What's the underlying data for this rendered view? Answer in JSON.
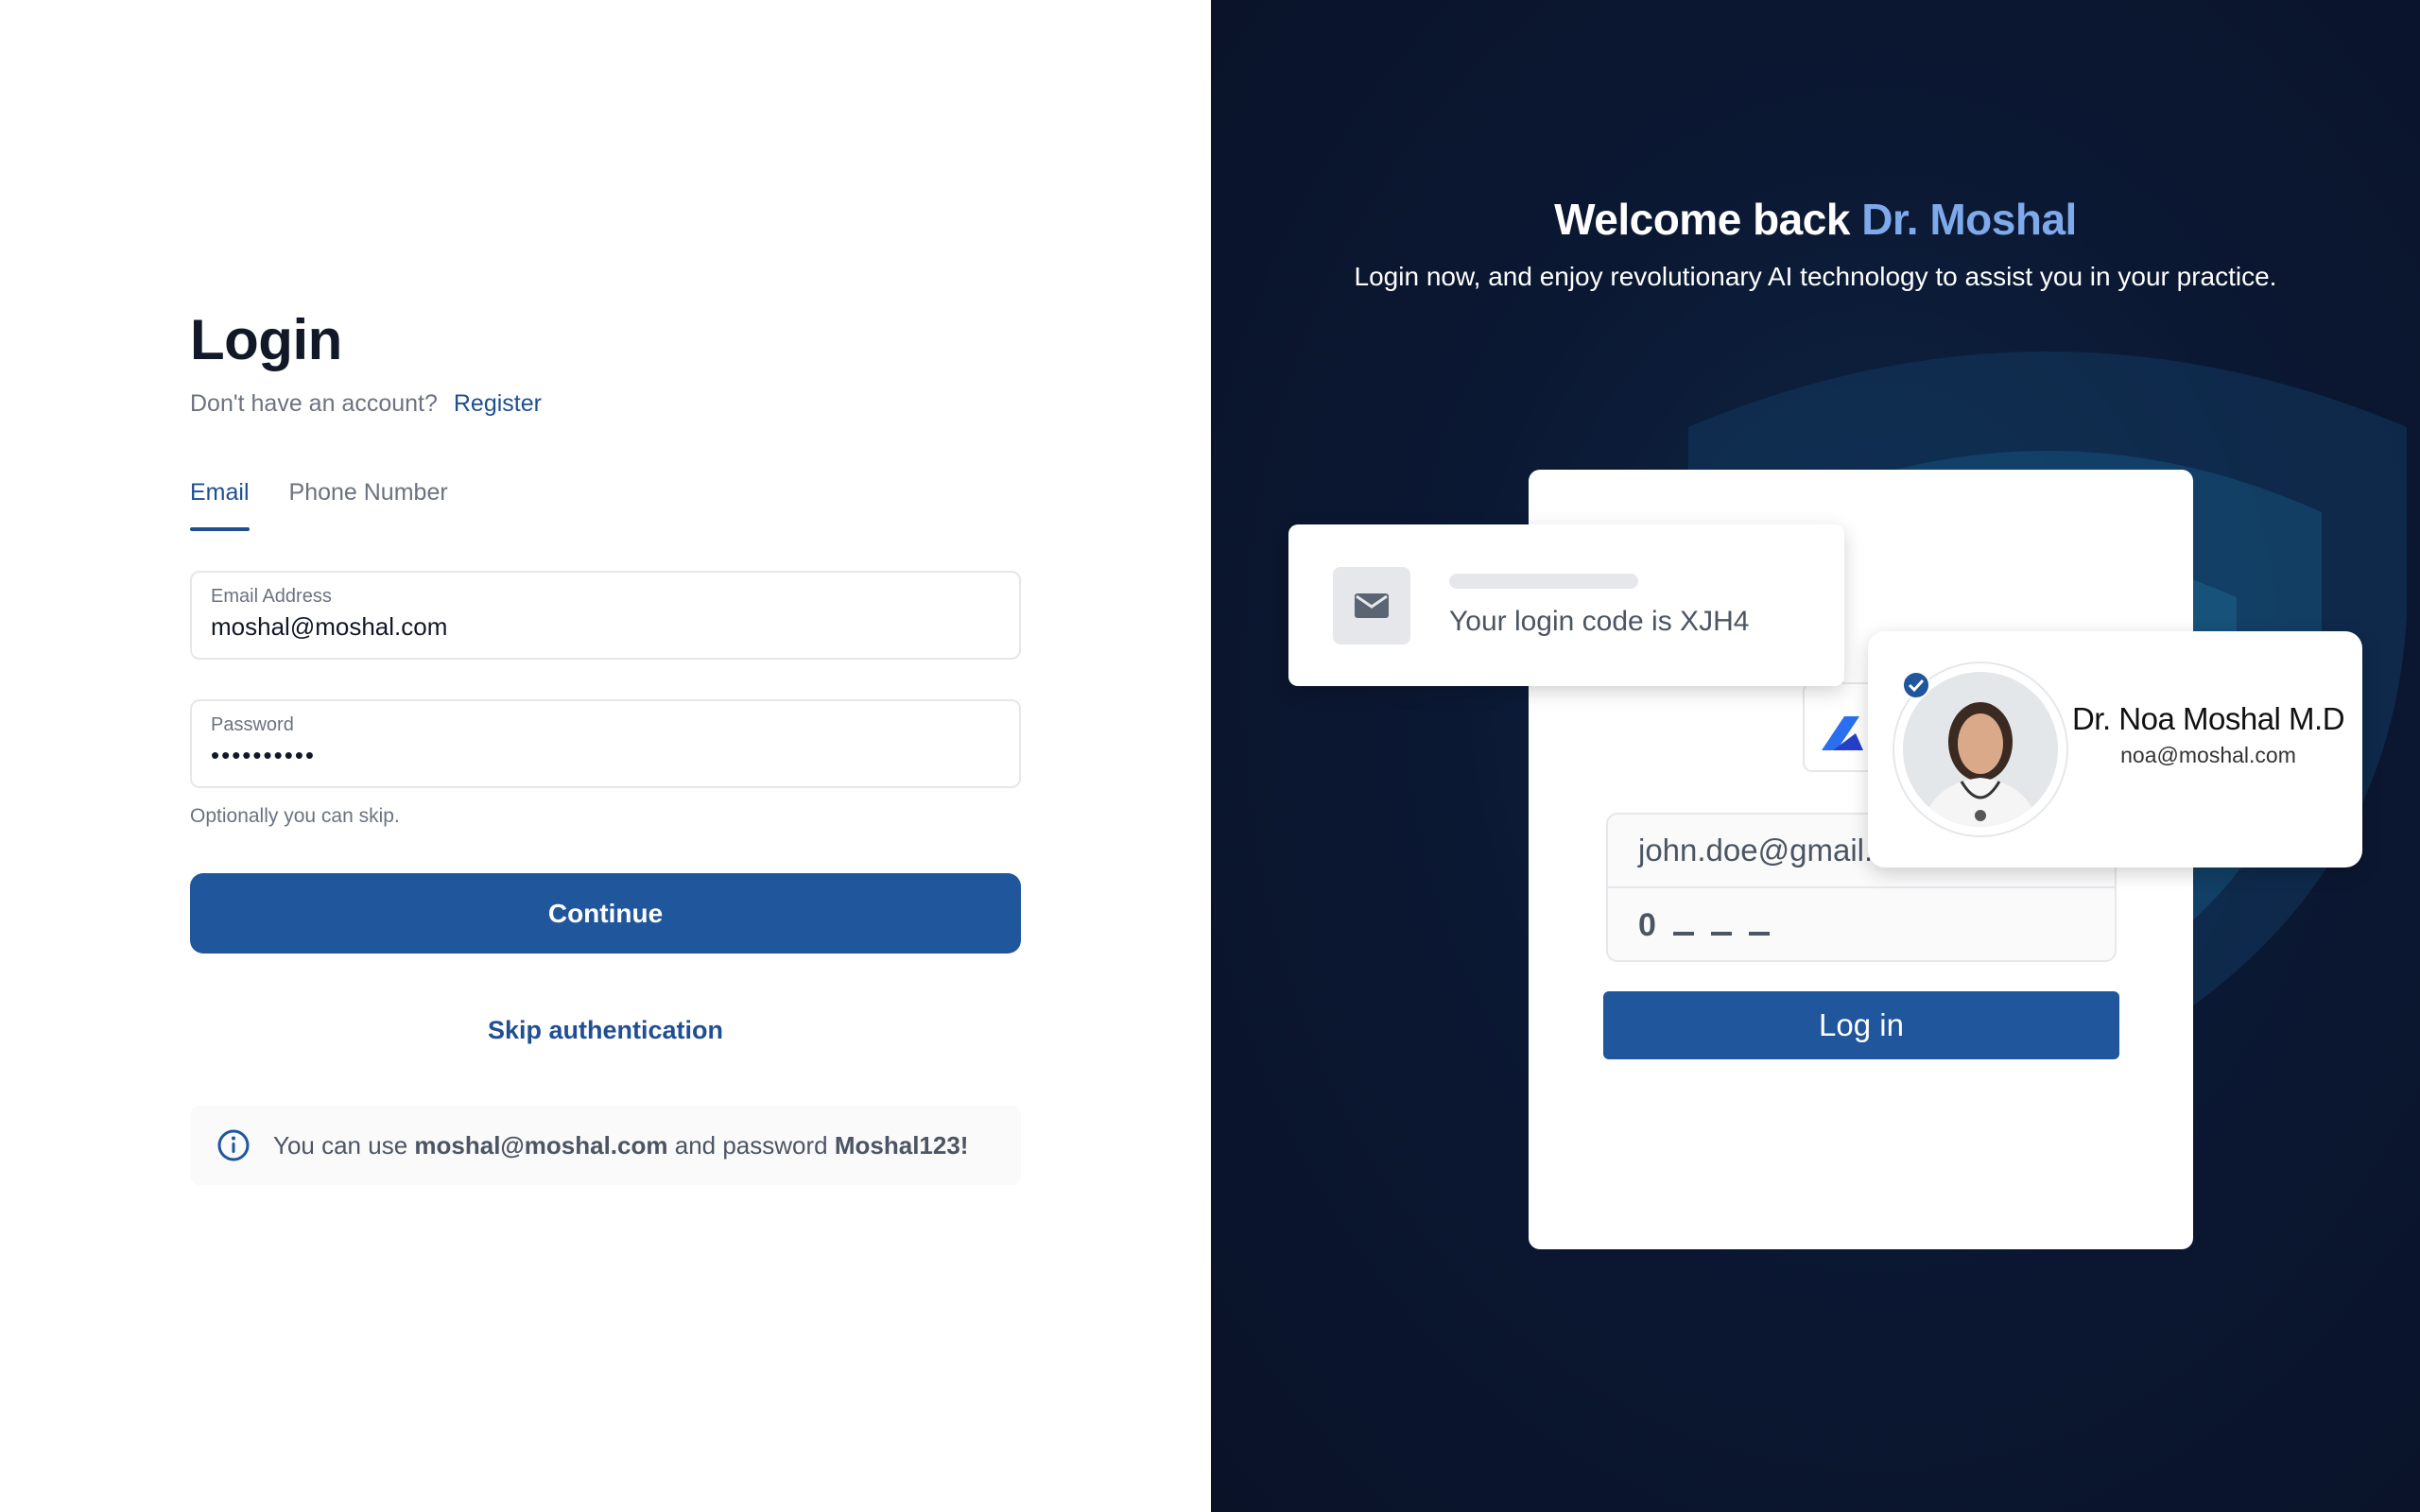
{
  "login": {
    "title": "Login",
    "register_prompt": "Don't have an account?",
    "register_link": "Register",
    "tabs": [
      {
        "label": "Email",
        "active": true
      },
      {
        "label": "Phone Number",
        "active": false
      }
    ],
    "email_field": {
      "label": "Email Address",
      "value": "moshal@moshal.com"
    },
    "password_field": {
      "label": "Password",
      "value": "••••••••••"
    },
    "hint": "Optionally you can skip.",
    "continue_label": "Continue",
    "skip_label": "Skip authentication",
    "info": {
      "prefix": "You can use",
      "email": "moshal@moshal.com",
      "middle": "and password",
      "password": "Moshal123!"
    }
  },
  "promo": {
    "welcome_prefix": "Welcome back",
    "welcome_name": "Dr. Moshal",
    "subtitle": "Login now, and enjoy revolutionary AI technology to assist you in your practice.",
    "code_message": "Your login code is XJH4",
    "form_email": "john.doe@gmail.com",
    "otp_first_digit": "0",
    "login_button": "Log in",
    "doctor": {
      "name": "Dr. Noa Moshal M.D",
      "email": "noa@moshal.com"
    }
  },
  "colors": {
    "primary": "#1f569c",
    "link": "#1f4f91",
    "accent": "#7ea9ea",
    "dark_bg": "#0b1833"
  },
  "icons": [
    "info-icon",
    "mail-icon",
    "verified-check-icon",
    "shield-graphic",
    "app-logo"
  ]
}
